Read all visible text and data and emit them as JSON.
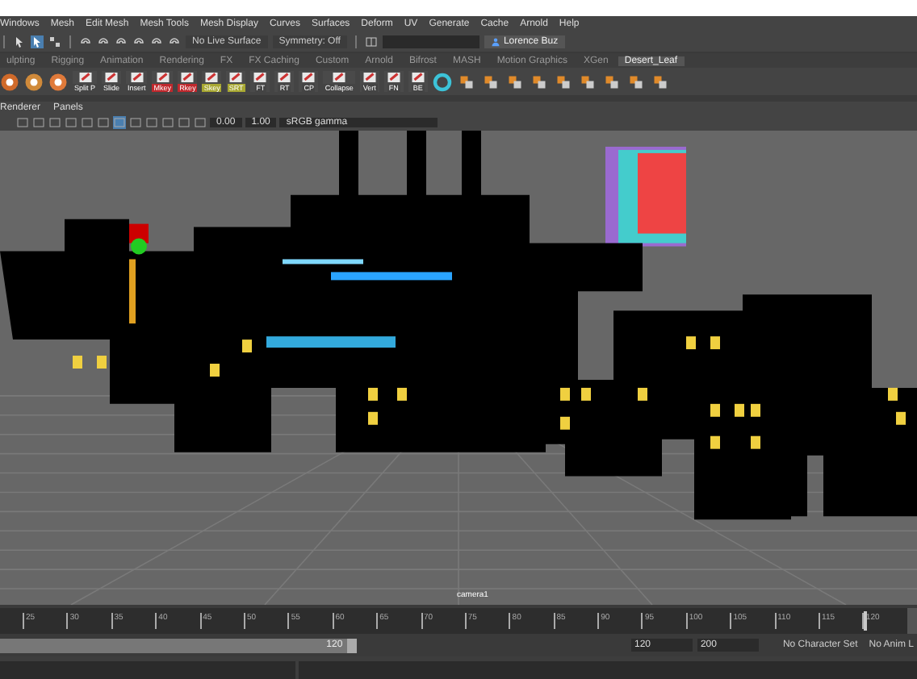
{
  "menu_bar": [
    "Windows",
    "Mesh",
    "Edit Mesh",
    "Mesh Tools",
    "Mesh Display",
    "Curves",
    "Surfaces",
    "Deform",
    "UV",
    "Generate",
    "Cache",
    "Arnold",
    "Help"
  ],
  "status_line": {
    "live_surface": "No Live Surface",
    "symmetry": "Symmetry: Off",
    "user": "Lorence Buz"
  },
  "shelf_tabs": [
    {
      "label": "ulpting",
      "selected": false
    },
    {
      "label": "Rigging",
      "selected": false
    },
    {
      "label": "Animation",
      "selected": false
    },
    {
      "label": "Rendering",
      "selected": false
    },
    {
      "label": "FX",
      "selected": false
    },
    {
      "label": "FX Caching",
      "selected": false
    },
    {
      "label": "Custom",
      "selected": false
    },
    {
      "label": "Arnold",
      "selected": false
    },
    {
      "label": "Bifrost",
      "selected": false
    },
    {
      "label": "MASH",
      "selected": false
    },
    {
      "label": "Motion Graphics",
      "selected": false
    },
    {
      "label": "XGen",
      "selected": false
    },
    {
      "label": "Desert_Leaf",
      "selected": true
    }
  ],
  "shelf_buttons": [
    {
      "label": "Split P",
      "color": "#444444"
    },
    {
      "label": "Slide",
      "color": "#444444"
    },
    {
      "label": "Insert",
      "color": "#444444"
    },
    {
      "label": "Mkey",
      "color": "#c0282d"
    },
    {
      "label": "Rkey",
      "color": "#c0282d"
    },
    {
      "label": "Skey",
      "color": "#a8a832"
    },
    {
      "label": "SRT",
      "color": "#a8a832"
    },
    {
      "label": "FT",
      "color": "#444444"
    },
    {
      "label": "RT",
      "color": "#444444"
    },
    {
      "label": "CP",
      "color": "#444444"
    },
    {
      "label": "Collapse",
      "color": "#444444"
    },
    {
      "label": "Vert",
      "color": "#444444"
    },
    {
      "label": "FN",
      "color": "#444444"
    },
    {
      "label": "BE",
      "color": "#444444"
    }
  ],
  "panel_menu": [
    "Renderer",
    "Panels"
  ],
  "panel_toolbar": {
    "exposure": "0.00",
    "gamma": "1.00",
    "color_space": "sRGB gamma"
  },
  "viewport": {
    "camera": "camera1"
  },
  "time_slider": {
    "level": 1,
    "ticks": [
      "25",
      "30",
      "35",
      "40",
      "45",
      "50",
      "55",
      "60",
      "65",
      "70",
      "75",
      "80",
      "85",
      "90",
      "95",
      "100",
      "105",
      "110",
      "115",
      "120"
    ]
  },
  "range_slider": {
    "level": 0.57,
    "current": "120",
    "start": "120",
    "end": "200",
    "character_set": "No Character Set",
    "anim_layer": "No Anim L"
  }
}
